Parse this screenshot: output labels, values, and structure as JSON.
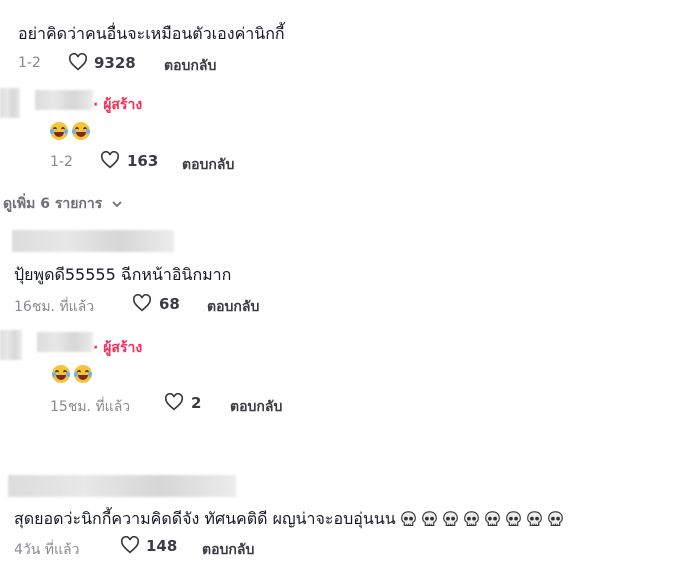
{
  "comments": [
    {
      "text": "อย่าคิดว่าคนอื่นจะเหมือนตัวเองค่านิกกี้",
      "date": "1-2",
      "likes": "9328",
      "reply": "ตอบกลับ"
    },
    {
      "author_tag": "· ผู้สร้าง",
      "date": "1-2",
      "likes": "163",
      "reply": "ตอบกลับ"
    },
    {
      "text": "ปุ้ยพูดดี55555 ฉีกหน้าอินิกมาก",
      "date": "16ชม. ที่แล้ว",
      "likes": "68",
      "reply": "ตอบกลับ"
    },
    {
      "author_tag": "· ผู้สร้าง",
      "date": "15ชม. ที่แล้ว",
      "likes": "2",
      "reply": "ตอบกลับ"
    },
    {
      "text": "สุดยอดว่ะนิกกี้ความคิดดีจัง ทัศนคติดี ผญน่าจะอบอุ่นนน",
      "date": "4วัน ที่แล้ว",
      "likes": "148",
      "reply": "ตอบกลับ"
    }
  ],
  "view_more": "ดูเพิ่ม 6 รายการ",
  "icons": {
    "heart": "heart-outline-icon",
    "chevron": "chevron-down-icon",
    "emoji_laugh": "face-with-tears-of-joy-icon",
    "emoji_skull": "skull-icon"
  },
  "colors": {
    "creator_tag": "#fe2c55",
    "meta_text": "#8a8b91"
  }
}
